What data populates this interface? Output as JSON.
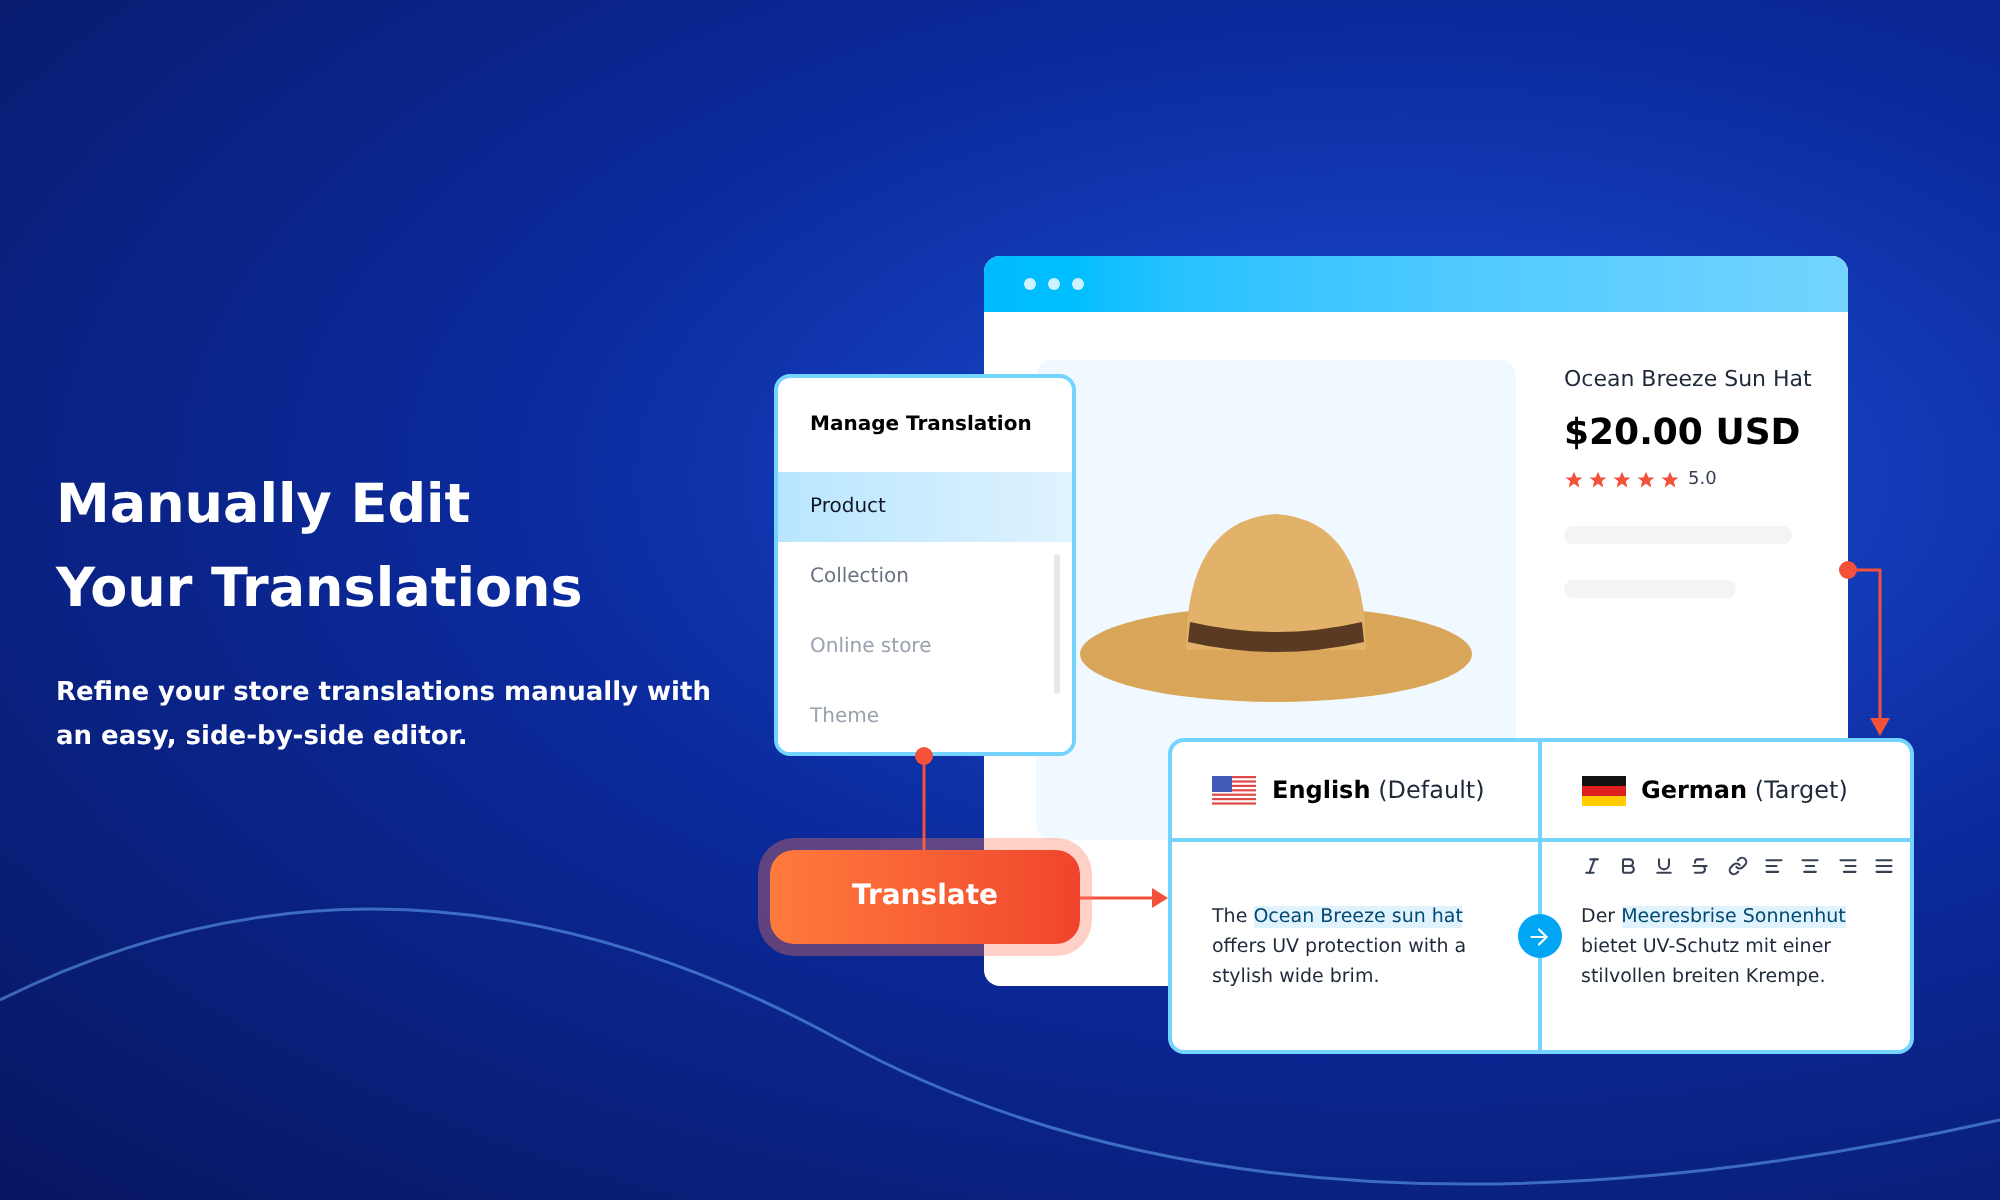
{
  "hero": {
    "title_lines": [
      "Manually Edit",
      "Your Translations"
    ],
    "subtitle": "Refine your store translations manually with an easy, side-by-side editor."
  },
  "menu": {
    "title": "Manage Translation",
    "items": [
      {
        "label": "Product",
        "selected": true
      },
      {
        "label": "Collection",
        "selected": false
      },
      {
        "label": "Online store",
        "selected": false
      },
      {
        "label": "Theme",
        "selected": false
      }
    ]
  },
  "product": {
    "name": "Ocean Breeze Sun Hat",
    "price": "$20.00 USD",
    "stars": 5,
    "rating": "5.0"
  },
  "translate_button": "Translate",
  "editor": {
    "source": {
      "language": "English",
      "role": "(Default)",
      "before": "The",
      "highlight": "Ocean Breeze sun hat",
      "after": "offers UV protection with a stylish wide brim."
    },
    "target": {
      "language": "German",
      "role": "(Target)",
      "before": "Der",
      "highlight": "Meeresbrise Sonnenhut",
      "after": "bietet UV-Schutz mit einer stilvollen breiten Krempe."
    },
    "toolbar": [
      {
        "kind": "italic"
      },
      {
        "kind": "bold"
      },
      {
        "kind": "underline"
      },
      {
        "kind": "strikethrough"
      },
      {
        "kind": "link"
      },
      {
        "kind": "align-left"
      },
      {
        "kind": "align-center"
      },
      {
        "kind": "align-right"
      },
      {
        "kind": "align-justify"
      }
    ]
  }
}
